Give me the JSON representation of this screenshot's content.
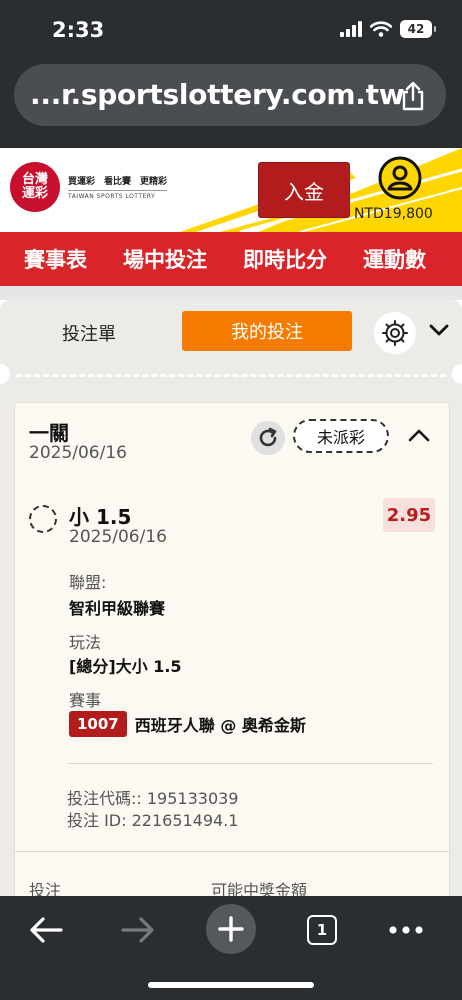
{
  "status": {
    "time": "2:33",
    "battery": "42"
  },
  "browser": {
    "url": "...r.sportslottery.com.tw"
  },
  "header": {
    "logo_line1": "台灣",
    "logo_line2": "運彩",
    "slogan": "買運彩　看比賽　更精彩",
    "logo_en": "TAIWAN SPORTS LOTTERY",
    "deposit_label": "入金",
    "balance": "NTD19,800"
  },
  "nav": {
    "items": [
      "賽事表",
      "場中投注",
      "即時比分",
      "運動數"
    ]
  },
  "tabs": {
    "bet_slip": "投注單",
    "my_bets": "我的投注"
  },
  "bet": {
    "type": "一關",
    "date": "2025/06/16",
    "status": "未派彩",
    "selection": "小 1.5",
    "selection_date": "2025/06/16",
    "odds": "2.95",
    "league_label": "聯盟:",
    "league": "智利甲級聯賽",
    "market_label": "玩法",
    "market": "[總分]大小 1.5",
    "event_label": "賽事",
    "event_code": "1007",
    "event_name": "西班牙人聯 @ 奧希金斯",
    "bet_code": "投注代碼:: 195133039",
    "bet_id": "投注 ID: 221651494.1",
    "stake_label": "投注",
    "payout_label": "可能中獎金額"
  },
  "toolbar": {
    "tab_count": "1"
  },
  "colors": {
    "brand_red": "#d9252a",
    "accent_orange": "#f57c00",
    "deposit_red": "#b31c1c",
    "brand_yellow": "#ffd600"
  }
}
